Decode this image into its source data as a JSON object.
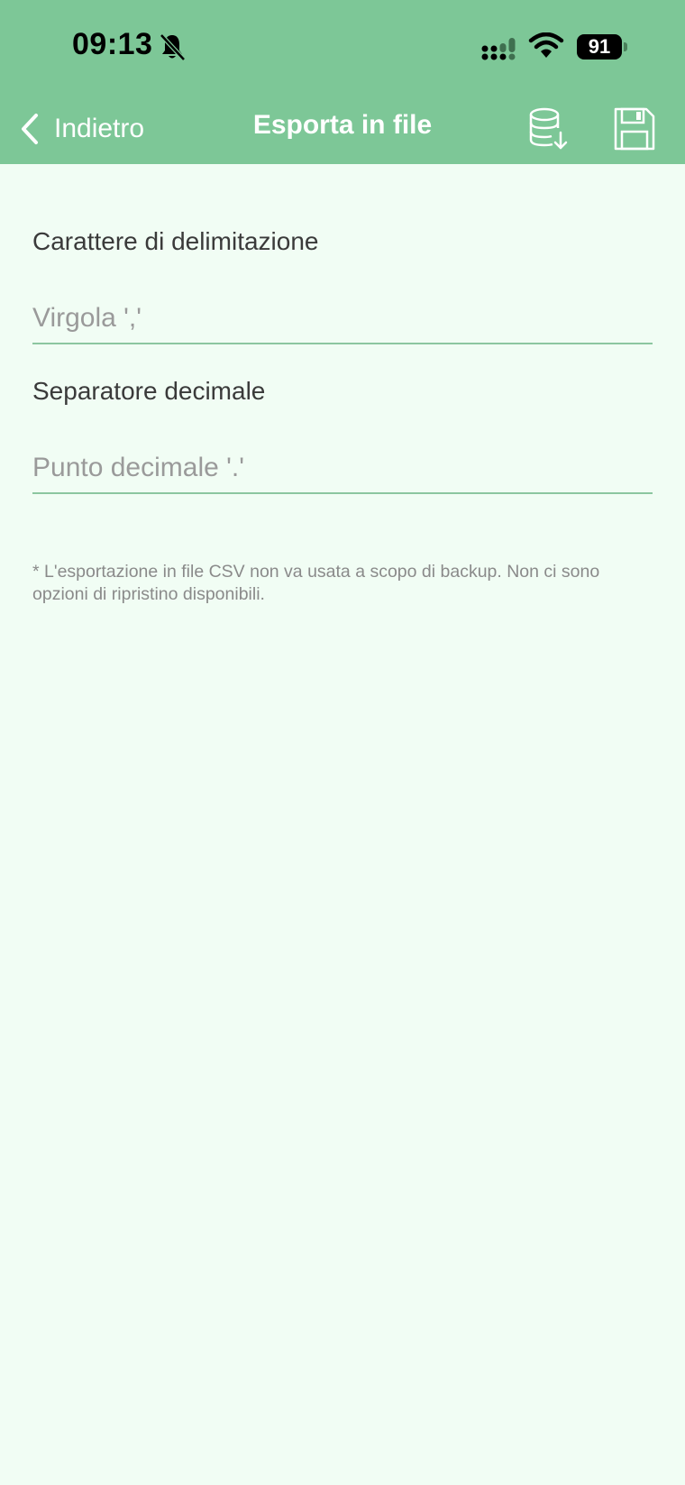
{
  "status_bar": {
    "time": "09:13",
    "battery_level": "91",
    "icons": [
      "bell-slash-icon",
      "cellular-signal-icon",
      "wifi-icon",
      "battery-icon"
    ]
  },
  "nav": {
    "back_label": "Indietro",
    "title": "Esporta in file",
    "actions": [
      "database-export-icon",
      "floppy-disk-save-icon"
    ]
  },
  "form": {
    "delimiter": {
      "label": "Carattere di delimitazione",
      "value": "",
      "placeholder": "Virgola ','"
    },
    "decimal_separator": {
      "label": "Separatore decimale",
      "value": "",
      "placeholder": "Punto decimale '.'"
    }
  },
  "note": "* L'esportazione in file CSV non va usata a scopo di backup. Non ci sono opzioni di ripristino disponibili.",
  "colors": {
    "header": "#7dc797",
    "background": "#f1fdf4",
    "underline": "#8cc6a0"
  }
}
